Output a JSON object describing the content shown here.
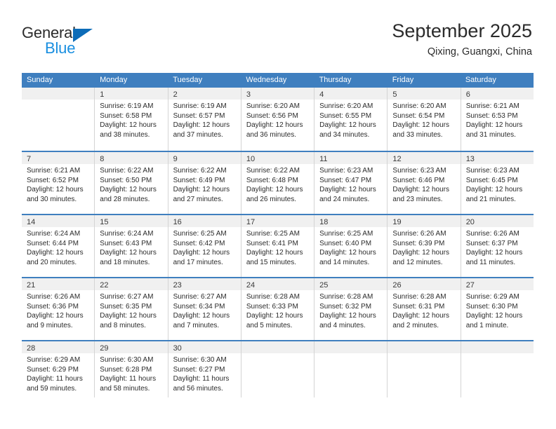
{
  "brand": {
    "name_part1": "General",
    "name_part2": "Blue",
    "triangle_color": "#0d6cb8",
    "blue_text_color": "#1a8fe0"
  },
  "header": {
    "title": "September 2025",
    "subtitle": "Qixing, Guangxi, China"
  },
  "theme": {
    "header_row_bg": "#3f7fbf",
    "daynum_band_bg": "#f0f0f0",
    "cell_border": "#d4d4d4",
    "text": "#2b2b2b"
  },
  "calendar": {
    "weekdays": [
      "Sunday",
      "Monday",
      "Tuesday",
      "Wednesday",
      "Thursday",
      "Friday",
      "Saturday"
    ],
    "weeks": [
      [
        {
          "day": "",
          "sunrise": "",
          "sunset": "",
          "daylight": ""
        },
        {
          "day": "1",
          "sunrise": "Sunrise: 6:19 AM",
          "sunset": "Sunset: 6:58 PM",
          "daylight": "Daylight: 12 hours and 38 minutes."
        },
        {
          "day": "2",
          "sunrise": "Sunrise: 6:19 AM",
          "sunset": "Sunset: 6:57 PM",
          "daylight": "Daylight: 12 hours and 37 minutes."
        },
        {
          "day": "3",
          "sunrise": "Sunrise: 6:20 AM",
          "sunset": "Sunset: 6:56 PM",
          "daylight": "Daylight: 12 hours and 36 minutes."
        },
        {
          "day": "4",
          "sunrise": "Sunrise: 6:20 AM",
          "sunset": "Sunset: 6:55 PM",
          "daylight": "Daylight: 12 hours and 34 minutes."
        },
        {
          "day": "5",
          "sunrise": "Sunrise: 6:20 AM",
          "sunset": "Sunset: 6:54 PM",
          "daylight": "Daylight: 12 hours and 33 minutes."
        },
        {
          "day": "6",
          "sunrise": "Sunrise: 6:21 AM",
          "sunset": "Sunset: 6:53 PM",
          "daylight": "Daylight: 12 hours and 31 minutes."
        }
      ],
      [
        {
          "day": "7",
          "sunrise": "Sunrise: 6:21 AM",
          "sunset": "Sunset: 6:52 PM",
          "daylight": "Daylight: 12 hours and 30 minutes."
        },
        {
          "day": "8",
          "sunrise": "Sunrise: 6:22 AM",
          "sunset": "Sunset: 6:50 PM",
          "daylight": "Daylight: 12 hours and 28 minutes."
        },
        {
          "day": "9",
          "sunrise": "Sunrise: 6:22 AM",
          "sunset": "Sunset: 6:49 PM",
          "daylight": "Daylight: 12 hours and 27 minutes."
        },
        {
          "day": "10",
          "sunrise": "Sunrise: 6:22 AM",
          "sunset": "Sunset: 6:48 PM",
          "daylight": "Daylight: 12 hours and 26 minutes."
        },
        {
          "day": "11",
          "sunrise": "Sunrise: 6:23 AM",
          "sunset": "Sunset: 6:47 PM",
          "daylight": "Daylight: 12 hours and 24 minutes."
        },
        {
          "day": "12",
          "sunrise": "Sunrise: 6:23 AM",
          "sunset": "Sunset: 6:46 PM",
          "daylight": "Daylight: 12 hours and 23 minutes."
        },
        {
          "day": "13",
          "sunrise": "Sunrise: 6:23 AM",
          "sunset": "Sunset: 6:45 PM",
          "daylight": "Daylight: 12 hours and 21 minutes."
        }
      ],
      [
        {
          "day": "14",
          "sunrise": "Sunrise: 6:24 AM",
          "sunset": "Sunset: 6:44 PM",
          "daylight": "Daylight: 12 hours and 20 minutes."
        },
        {
          "day": "15",
          "sunrise": "Sunrise: 6:24 AM",
          "sunset": "Sunset: 6:43 PM",
          "daylight": "Daylight: 12 hours and 18 minutes."
        },
        {
          "day": "16",
          "sunrise": "Sunrise: 6:25 AM",
          "sunset": "Sunset: 6:42 PM",
          "daylight": "Daylight: 12 hours and 17 minutes."
        },
        {
          "day": "17",
          "sunrise": "Sunrise: 6:25 AM",
          "sunset": "Sunset: 6:41 PM",
          "daylight": "Daylight: 12 hours and 15 minutes."
        },
        {
          "day": "18",
          "sunrise": "Sunrise: 6:25 AM",
          "sunset": "Sunset: 6:40 PM",
          "daylight": "Daylight: 12 hours and 14 minutes."
        },
        {
          "day": "19",
          "sunrise": "Sunrise: 6:26 AM",
          "sunset": "Sunset: 6:39 PM",
          "daylight": "Daylight: 12 hours and 12 minutes."
        },
        {
          "day": "20",
          "sunrise": "Sunrise: 6:26 AM",
          "sunset": "Sunset: 6:37 PM",
          "daylight": "Daylight: 12 hours and 11 minutes."
        }
      ],
      [
        {
          "day": "21",
          "sunrise": "Sunrise: 6:26 AM",
          "sunset": "Sunset: 6:36 PM",
          "daylight": "Daylight: 12 hours and 9 minutes."
        },
        {
          "day": "22",
          "sunrise": "Sunrise: 6:27 AM",
          "sunset": "Sunset: 6:35 PM",
          "daylight": "Daylight: 12 hours and 8 minutes."
        },
        {
          "day": "23",
          "sunrise": "Sunrise: 6:27 AM",
          "sunset": "Sunset: 6:34 PM",
          "daylight": "Daylight: 12 hours and 7 minutes."
        },
        {
          "day": "24",
          "sunrise": "Sunrise: 6:28 AM",
          "sunset": "Sunset: 6:33 PM",
          "daylight": "Daylight: 12 hours and 5 minutes."
        },
        {
          "day": "25",
          "sunrise": "Sunrise: 6:28 AM",
          "sunset": "Sunset: 6:32 PM",
          "daylight": "Daylight: 12 hours and 4 minutes."
        },
        {
          "day": "26",
          "sunrise": "Sunrise: 6:28 AM",
          "sunset": "Sunset: 6:31 PM",
          "daylight": "Daylight: 12 hours and 2 minutes."
        },
        {
          "day": "27",
          "sunrise": "Sunrise: 6:29 AM",
          "sunset": "Sunset: 6:30 PM",
          "daylight": "Daylight: 12 hours and 1 minute."
        }
      ],
      [
        {
          "day": "28",
          "sunrise": "Sunrise: 6:29 AM",
          "sunset": "Sunset: 6:29 PM",
          "daylight": "Daylight: 11 hours and 59 minutes."
        },
        {
          "day": "29",
          "sunrise": "Sunrise: 6:30 AM",
          "sunset": "Sunset: 6:28 PM",
          "daylight": "Daylight: 11 hours and 58 minutes."
        },
        {
          "day": "30",
          "sunrise": "Sunrise: 6:30 AM",
          "sunset": "Sunset: 6:27 PM",
          "daylight": "Daylight: 11 hours and 56 minutes."
        },
        {
          "day": "",
          "sunrise": "",
          "sunset": "",
          "daylight": ""
        },
        {
          "day": "",
          "sunrise": "",
          "sunset": "",
          "daylight": ""
        },
        {
          "day": "",
          "sunrise": "",
          "sunset": "",
          "daylight": ""
        },
        {
          "day": "",
          "sunrise": "",
          "sunset": "",
          "daylight": ""
        }
      ]
    ]
  }
}
